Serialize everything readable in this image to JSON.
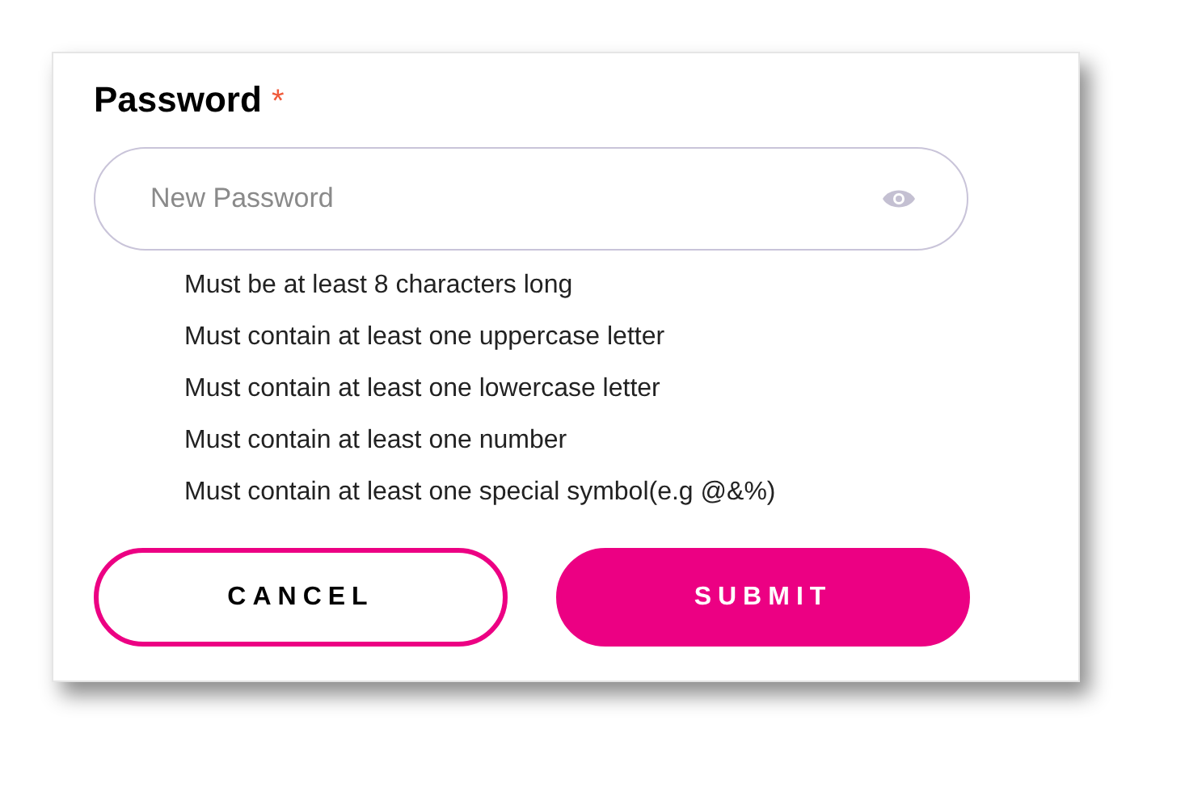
{
  "field": {
    "label": "Password",
    "required_mark": "*",
    "placeholder": "New Password"
  },
  "rules": [
    "Must be at least 8 characters long",
    "Must contain at least one uppercase letter",
    "Must contain at least one lowercase letter",
    "Must contain at least one number",
    "Must contain at least one special symbol(e.g @&%)"
  ],
  "buttons": [
    {
      "label": "CANCEL",
      "kind": "outline"
    },
    {
      "label": "SUBMIT",
      "kind": "filled"
    }
  ]
}
